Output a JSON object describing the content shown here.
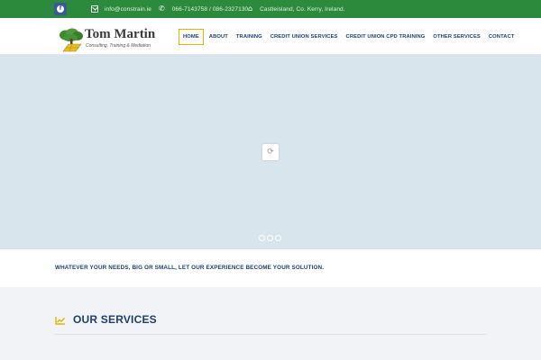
{
  "topbar": {
    "social": {
      "icon": "facebook-icon"
    },
    "email": {
      "icon": "envelope-icon",
      "text": "info@constrain.ie"
    },
    "phone": {
      "icon": "phone-icon",
      "text": "066-7143758 / 086-2327130"
    },
    "address": {
      "icon": "home-icon",
      "text": "Castleisland, Co. Kerry, Ireland."
    }
  },
  "logo": {
    "title": "Tom Martin",
    "subtitle": "Consulting, Training & Mediation",
    "icon": "tree-logo-icon"
  },
  "nav": {
    "items": [
      {
        "label": "HOME",
        "active": true
      },
      {
        "label": "ABOUT"
      },
      {
        "label": "TRAINING"
      },
      {
        "label": "CREDIT UNION SERVICES"
      },
      {
        "label": "CREDIT UNION CPD TRAINING"
      },
      {
        "label": "OTHER SERVICES"
      },
      {
        "label": "CONTACT"
      }
    ]
  },
  "hero": {
    "loader_icon": "spinner-icon",
    "slide_count": 3
  },
  "tagline": "WHATEVER YOUR NEEDS, BIG OR SMALL, LET OUR EXPERIENCE BECOME YOUR SOLUTION.",
  "services": {
    "icon": "line-chart-icon",
    "title": "OUR SERVICES"
  },
  "colors": {
    "topbar": "#2b8a3b",
    "brand_navy": "#1f3f6b",
    "accent_gold": "#e0b400",
    "hero_bg": "#d8e5ed"
  }
}
